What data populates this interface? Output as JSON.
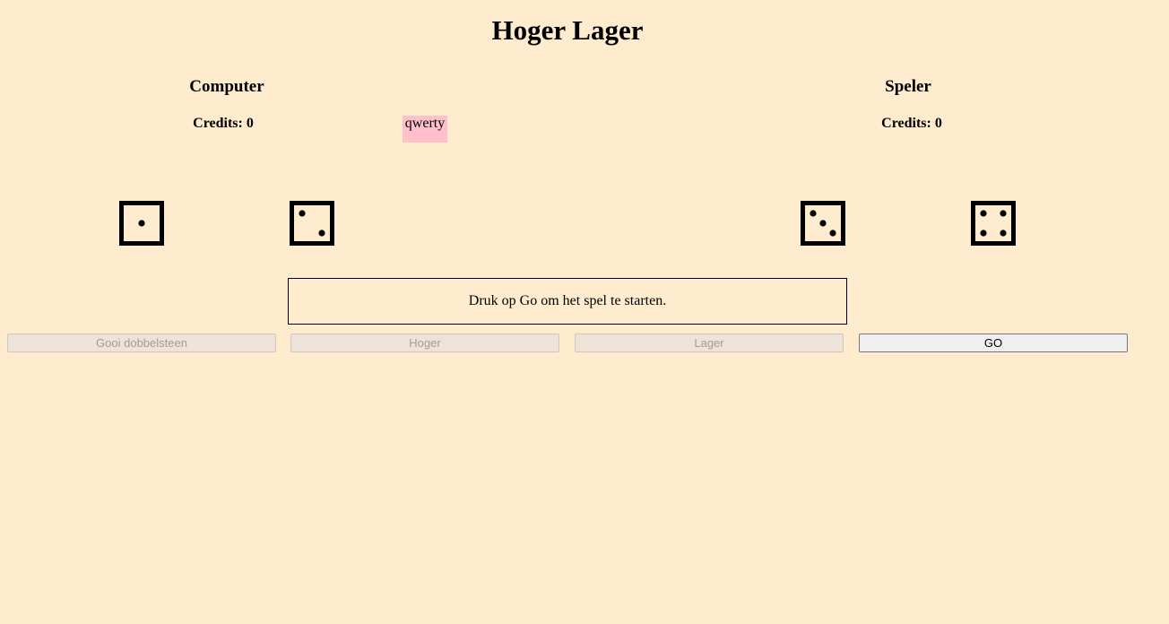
{
  "title": "Hoger Lager",
  "computer": {
    "name": "Computer",
    "credits_label": "Credits: ",
    "credits": "0",
    "dice": [
      1,
      2
    ]
  },
  "player": {
    "name": "Speler",
    "credits_label": "Credits: ",
    "credits": "0",
    "dice": [
      3,
      4
    ]
  },
  "tag": "qwerty",
  "message": "Druk op Go om het spel te starten.",
  "buttons": {
    "roll": "Gooi dobbelsteen",
    "higher": "Hoger",
    "lower": "Lager",
    "go": "GO"
  }
}
